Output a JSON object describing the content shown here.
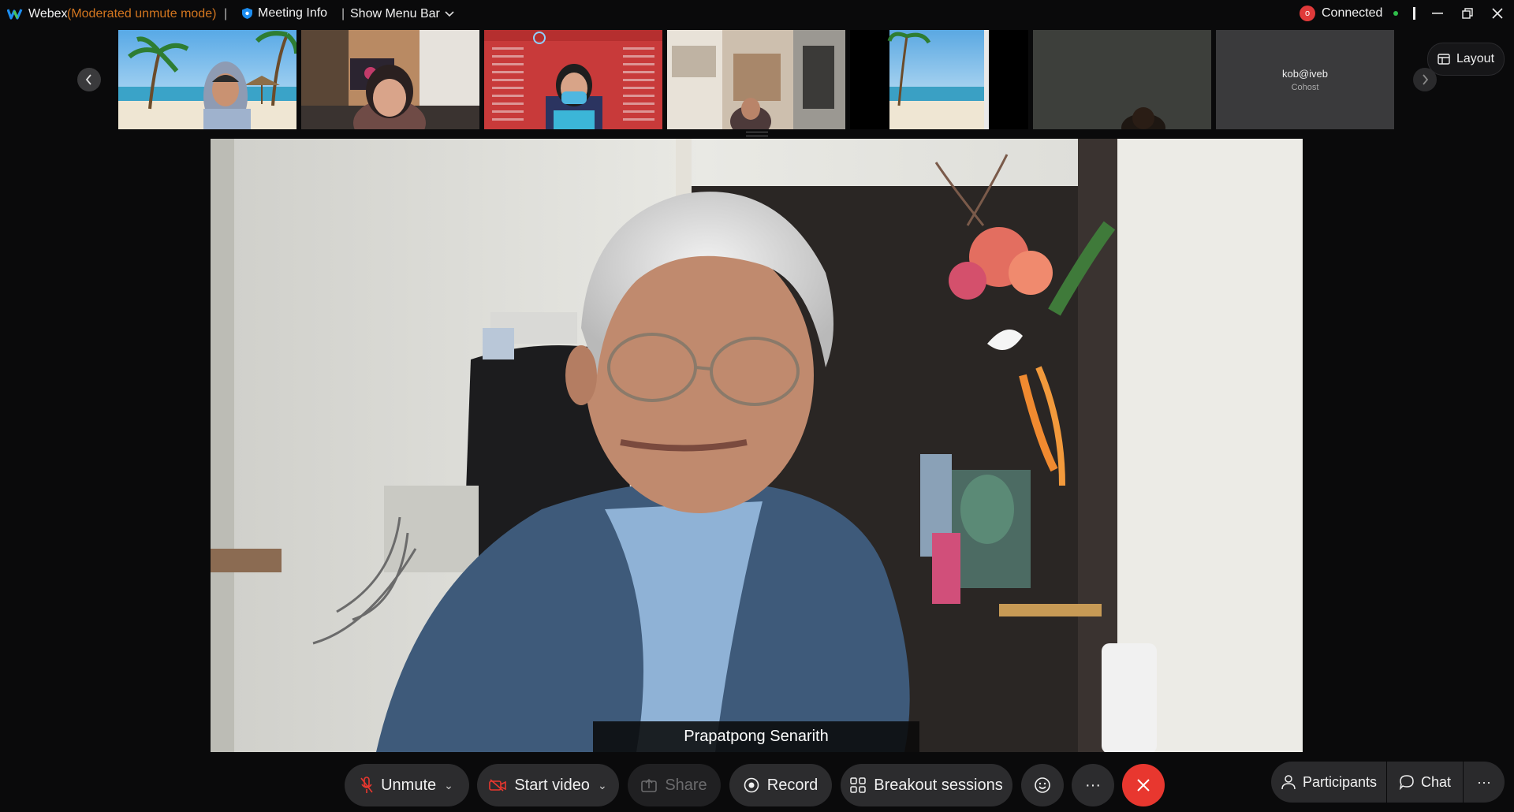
{
  "titlebar": {
    "app_name": "Webex",
    "mode": "(Moderated unmute mode)",
    "separator": "|",
    "meeting_info": "Meeting Info",
    "show_menu_bar": "Show Menu Bar",
    "connection_status": "Connected",
    "recording_badge": "o"
  },
  "strip": {
    "layout_label": "Layout",
    "cohost_name": "kob@iveb",
    "cohost_role": "Cohost"
  },
  "main": {
    "speaker_name": "Prapatpong Senarith"
  },
  "controls": {
    "unmute": "Unmute",
    "start_video": "Start video",
    "share": "Share",
    "record": "Record",
    "breakout": "Breakout sessions",
    "more": "···",
    "participants": "Participants",
    "chat": "Chat",
    "side_more": "···"
  },
  "colors": {
    "accent_orange": "#d3761f",
    "end_red": "#e8372f",
    "connected_green": "#2fbf4a"
  }
}
